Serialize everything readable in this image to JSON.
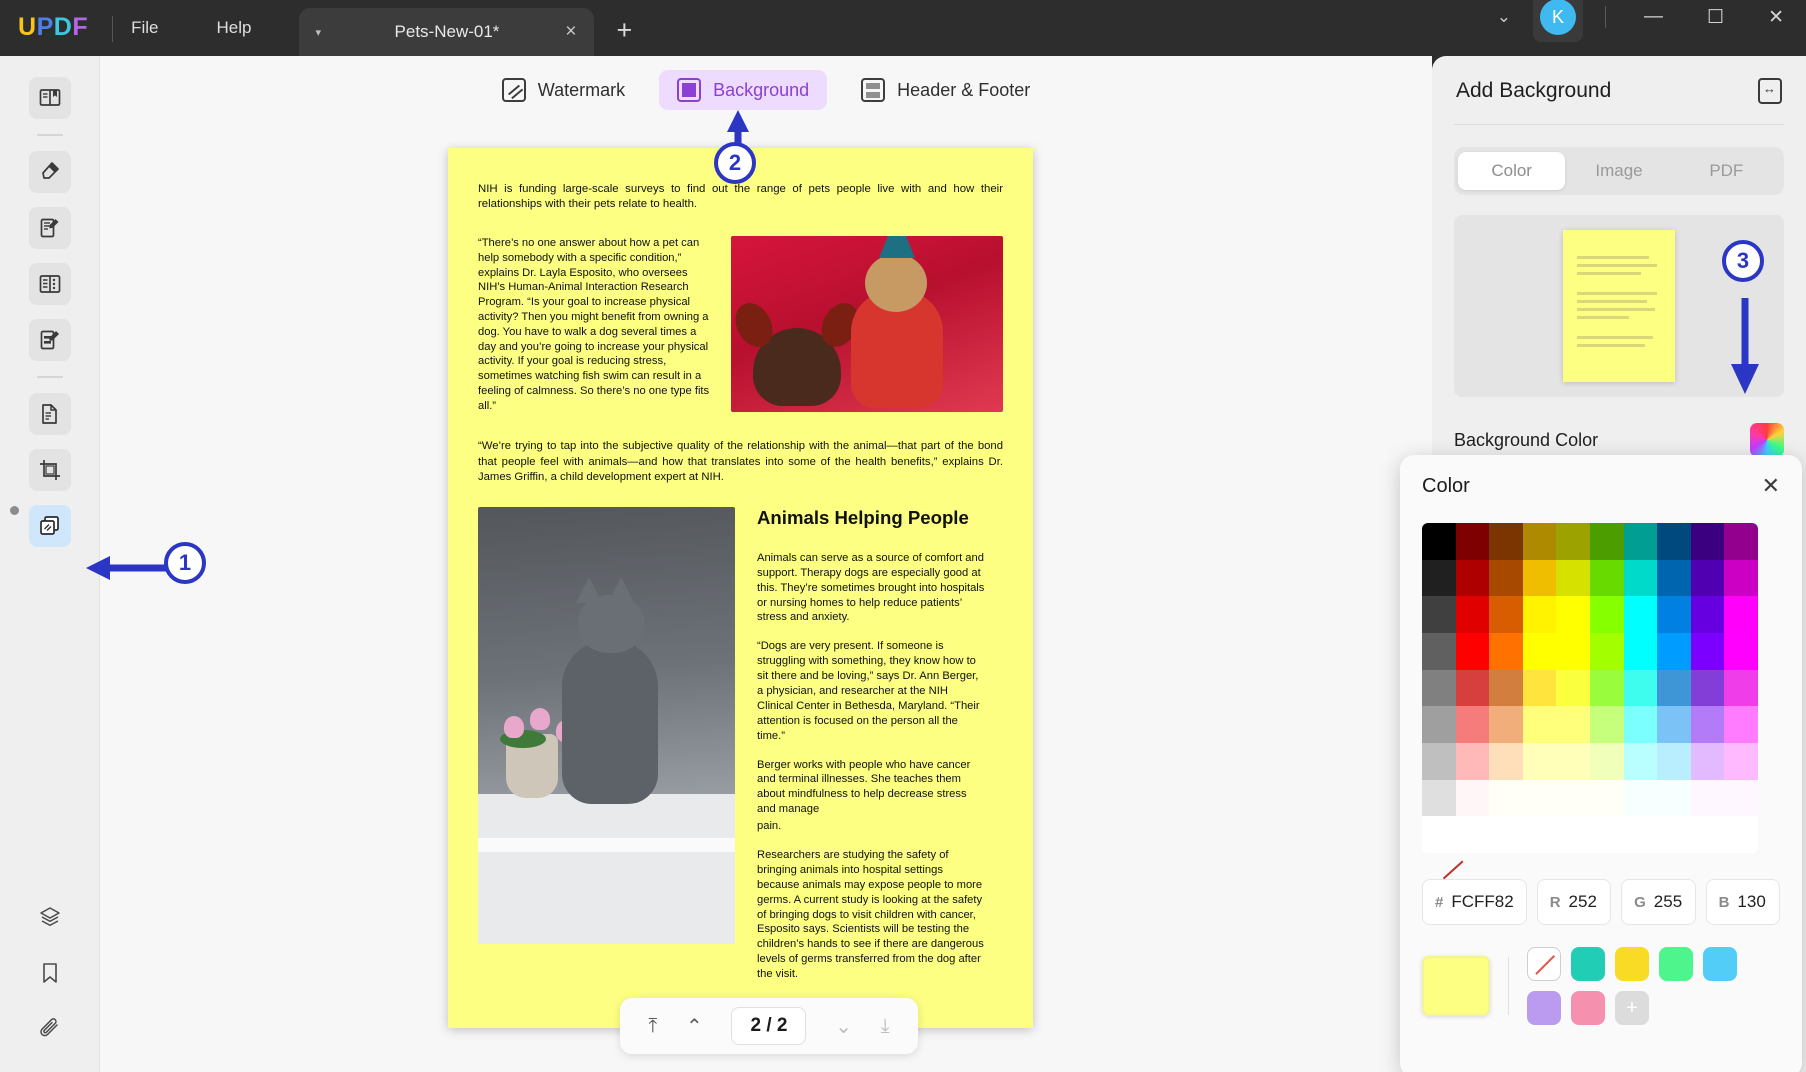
{
  "titlebar": {
    "logo": [
      "U",
      "P",
      "D",
      "F"
    ],
    "menus": [
      "File",
      "Help"
    ],
    "tab": {
      "name": "Pets-New-01*",
      "caret": "chevron-down-icon",
      "close": "×"
    },
    "new_tab": "+",
    "chevron": "⌄",
    "avatar_letter": "K",
    "minimize": "—",
    "maximize": "☐",
    "close": "✕"
  },
  "rail": {
    "items": [
      {
        "name": "reader",
        "glyph": "📖"
      },
      {
        "name": "annotate",
        "glyph": "🖊"
      },
      {
        "name": "edit-pdf",
        "glyph": "📝"
      },
      {
        "name": "page-organize",
        "glyph": "📑"
      },
      {
        "name": "form",
        "glyph": "🗒"
      },
      {
        "name": "convert",
        "glyph": "📄"
      },
      {
        "name": "crop",
        "glyph": "⛶"
      },
      {
        "name": "background-watermark",
        "glyph": "🗂"
      }
    ],
    "bottom": [
      {
        "name": "layers",
        "glyph": "◈"
      },
      {
        "name": "bookmark",
        "glyph": "🔖"
      },
      {
        "name": "attachment",
        "glyph": "📎"
      }
    ]
  },
  "toolbar_tabs": [
    {
      "label": "Watermark",
      "icon": "watermark-icon",
      "selected": false
    },
    {
      "label": "Background",
      "icon": "background-icon",
      "selected": true
    },
    {
      "label": "Header & Footer",
      "icon": "header-footer-icon",
      "selected": false
    }
  ],
  "document": {
    "lead": "NIH is funding large-scale surveys to find out the range of pets people live with and how their relationships with their pets relate to health.",
    "quote1": "“There’s no one answer about how a pet can help somebody with a  specific condition,” explains Dr. Layla Esposito, who oversees NIH’s Human-Animal  Interaction Research Program. “Is your goal to increase physical activity? Then you might benefit from owning a dog. You have to walk a dog several times a day and you’re going to increase your physical activity.  If your goal is reducing stress, sometimes watching fish swim can result in a feeling of calmness. So there’s no one type fits all.”",
    "quote2": "“We’re trying to tap into the subjective quality of the relationship with the animal—that part of the bond that people feel with animals—and how that translates into some of the health benefits,” explains Dr. James Griffin, a child development expert at NIH.",
    "section_title": "Animals Helping People",
    "para1": "Animals can serve as a source of comfort and support. Therapy dogs are especially good at this. They’re sometimes brought into hospitals or nursing homes to help reduce patients’ stress and anxiety.",
    "para2": "“Dogs are very present. If someone is struggling with something, they know how to sit there and be loving,”  says  Dr.  Ann Berger,  a  physician, and researcher at the NIH Clinical Center in Bethesda, Maryland. “Their  attention  is  focused  on  the person all the time.”",
    "para3": "Berger works with people who have cancer and terminal illnesses.  She  teaches  them about mindfulness to help decrease stress and manage",
    "para3b": "pain.",
    "para4": "Researchers are studying the safety of bringing animals into hospital settings because animals may expose people to more germs.  A  current study is looking at the safety of bringing dogs to visit children with cancer,  Esposito says. Scientists will be testing the children’s hands to see if there are dangerous levels of  germs transferred from the dog after the visit.",
    "page_bg_color": "#FCFF82"
  },
  "pagenav": {
    "first": "⤒",
    "prev": "⌃",
    "indicator": "2 / 2",
    "next": "⌄",
    "last": "⤓"
  },
  "right_panel": {
    "title": "Add Background",
    "collapse_icon": "collapse-panel-icon",
    "tabs": [
      {
        "label": "Color",
        "selected": true
      },
      {
        "label": "Image",
        "selected": false
      },
      {
        "label": "PDF",
        "selected": false
      }
    ],
    "preview_color": "#FCFF82",
    "background_color_label": "Background Color",
    "background_color_value": "#FCFF82"
  },
  "color_popover": {
    "title": "Color",
    "close": "✕",
    "hex_label": "#",
    "hex_value": "FCFF82",
    "r_label": "R",
    "r_value": "252",
    "g_label": "G",
    "g_value": "255",
    "b_label": "B",
    "b_value": "130",
    "current_swatch": "#FCFF82",
    "palette": [
      "none",
      "#22CDB6",
      "#F9DB26",
      "#4DF58C",
      "#52CDF7",
      "#BB9BF0",
      "#F590AE",
      "add"
    ],
    "add_label": "+",
    "grid_hues": [
      "#000000",
      "#7F0000",
      "#7A3500",
      "#AD8A00",
      "#9CA300",
      "#4C9E00",
      "#009E93",
      "#00497F",
      "#3A0080",
      "#93008E"
    ]
  },
  "callouts": [
    {
      "number": "1",
      "target": "rail-background-button"
    },
    {
      "number": "2",
      "target": "background-tab"
    },
    {
      "number": "3",
      "target": "background-color-swatch"
    }
  ]
}
